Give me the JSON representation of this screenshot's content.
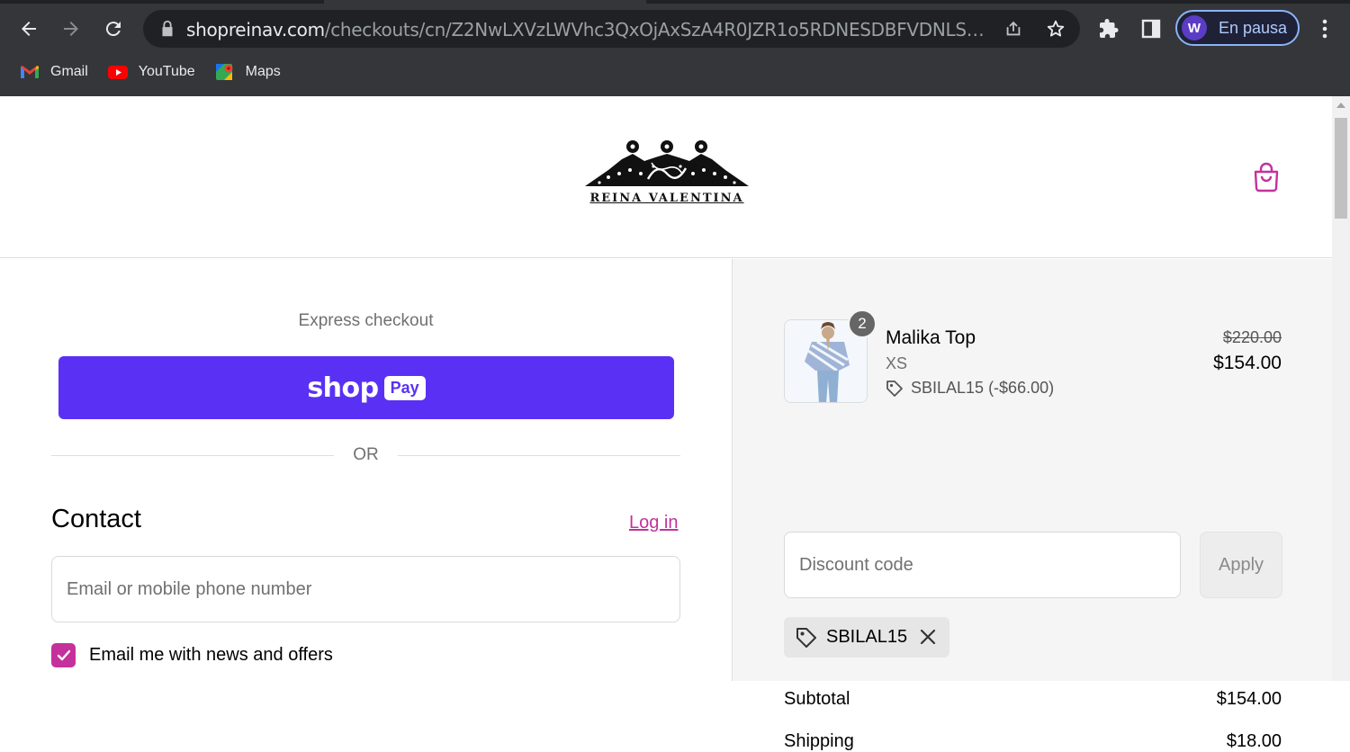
{
  "browser": {
    "url_host": "shopreinav.com",
    "url_path": "/checkouts/cn/Z2NwLXVzLWVhc3QxOjAxSzA4R0JZR1o5RDNESDBFVDNLSjZSV...",
    "profile_initial": "W",
    "profile_label": "En pausa",
    "bookmarks": [
      "Gmail",
      "YouTube",
      "Maps"
    ]
  },
  "store": {
    "brand": "REINA VALENTINA"
  },
  "checkout": {
    "express_label": "Express checkout",
    "shoppay_word": "shop",
    "shoppay_pay": "Pay",
    "or_label": "OR",
    "contact_heading": "Contact",
    "login_label": "Log in",
    "email_placeholder": "Email or mobile phone number",
    "news_label": "Email me with news and offers",
    "news_checked": true
  },
  "summary": {
    "item": {
      "quantity": "2",
      "name": "Malika Top",
      "variant": "XS",
      "discount_line": "SBILAL15 (-$66.00)",
      "original_price": "$220.00",
      "price": "$154.00"
    },
    "discount_placeholder": "Discount code",
    "apply_label": "Apply",
    "applied_code": "SBILAL15",
    "subtotal_label": "Subtotal",
    "subtotal_value": "$154.00",
    "shipping_label": "Shipping",
    "shipping_value": "$18.00"
  },
  "colors": {
    "accent": "#c4319c",
    "shoppay": "#5a31f4"
  }
}
